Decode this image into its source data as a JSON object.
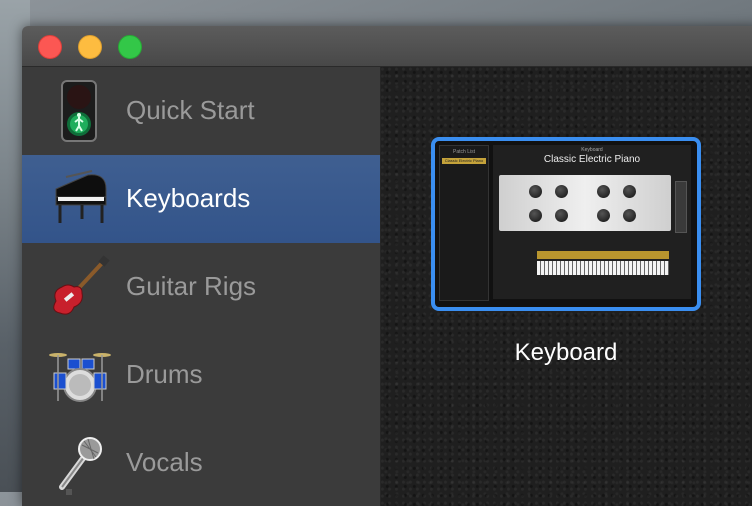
{
  "sidebar": {
    "items": [
      {
        "label": "Quick Start",
        "icon": "traffic-light-icon",
        "selected": false
      },
      {
        "label": "Keyboards",
        "icon": "grand-piano-icon",
        "selected": true
      },
      {
        "label": "Guitar Rigs",
        "icon": "electric-guitar-icon",
        "selected": false
      },
      {
        "label": "Drums",
        "icon": "drum-kit-icon",
        "selected": false
      },
      {
        "label": "Vocals",
        "icon": "microphone-icon",
        "selected": false
      }
    ]
  },
  "content": {
    "template": {
      "label": "Keyboard",
      "preview": {
        "patch_list_header": "Patch List",
        "selected_patch": "Classic Electric Piano",
        "header": "Keyboard",
        "instrument_name": "Classic Electric Piano"
      }
    }
  },
  "colors": {
    "selection": "#33548a",
    "accent_border": "#3a8ef0",
    "close": "#fc5753",
    "minimize": "#fdbc40",
    "zoom": "#33c748"
  }
}
